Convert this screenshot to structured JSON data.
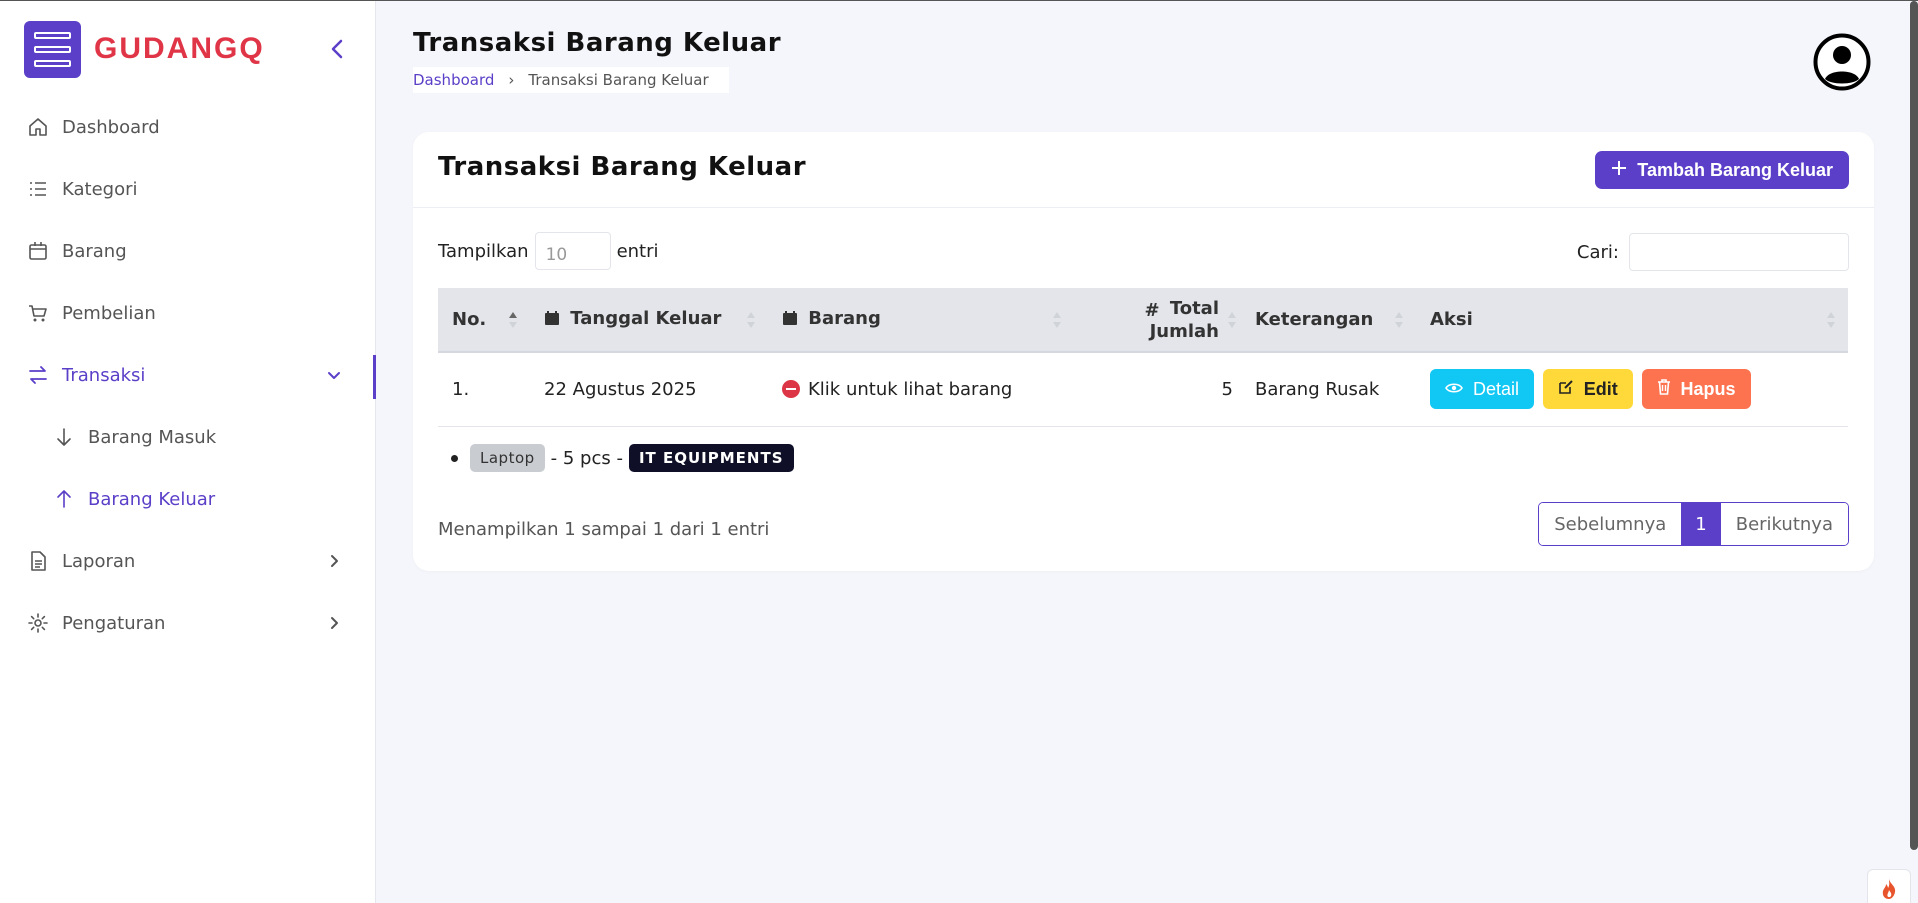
{
  "brand": {
    "name": "GUDANGQ"
  },
  "sidebar": {
    "items": [
      {
        "label": "Dashboard",
        "icon": "home-icon"
      },
      {
        "label": "Kategori",
        "icon": "list-icon"
      },
      {
        "label": "Barang",
        "icon": "box-icon"
      },
      {
        "label": "Pembelian",
        "icon": "cart-icon"
      },
      {
        "label": "Transaksi",
        "icon": "arrows-exchange-icon",
        "active": true,
        "expanded": true
      },
      {
        "label": "Barang Masuk",
        "icon": "arrow-down-icon",
        "sub": true
      },
      {
        "label": "Barang Keluar",
        "icon": "arrow-up-icon",
        "sub": true,
        "active": true
      },
      {
        "label": "Laporan",
        "icon": "document-icon"
      },
      {
        "label": "Pengaturan",
        "icon": "gear-icon"
      }
    ]
  },
  "header": {
    "title": "Transaksi Barang Keluar",
    "breadcrumb": [
      "Dashboard",
      "Transaksi Barang Keluar"
    ]
  },
  "card": {
    "title": "Transaksi Barang Keluar",
    "add_button": "Tambah Barang Keluar",
    "length_label_before": "Tampilkan",
    "length_value": "10",
    "length_label_after": "entri",
    "search_label": "Cari:",
    "search_value": ""
  },
  "table": {
    "columns": [
      "No.",
      "Tanggal Keluar",
      "Barang",
      "Total Jumlah",
      "Keterangan",
      "Aksi"
    ],
    "rows": [
      {
        "no": "1.",
        "tanggal": "22 Agustus 2025",
        "barang": "Klik untuk lihat barang",
        "total": "5",
        "keterangan": "Barang Rusak"
      }
    ],
    "actions": {
      "detail": "Detail",
      "edit": "Edit",
      "hapus": "Hapus"
    },
    "child_row": {
      "item": "Laptop",
      "qty_text": "- 5 pcs -",
      "category": "IT EQUIPMENTS"
    }
  },
  "footer": {
    "info": "Menampilkan 1 sampai 1 dari 1 entri",
    "prev": "Sebelumnya",
    "current_page": "1",
    "next": "Berikutnya"
  },
  "colors": {
    "accent": "#5b3fc8",
    "brand_text": "#e03547",
    "detail": "#11c8f5",
    "edit": "#ffd93a",
    "hapus": "#fd7350",
    "category_badge": "#0f1028"
  }
}
